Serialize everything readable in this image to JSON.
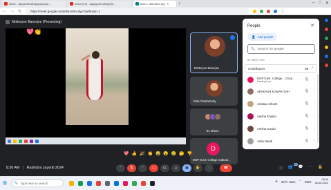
{
  "browser": {
    "tabs": [
      {
        "label": "Inbox - dgcpartich@dgcpapurgo...",
        "color": "#d93025",
        "active": false
      },
      {
        "label": "Inbox (19) - dgcpgovt.college@...",
        "color": "#d93025",
        "active": false
      },
      {
        "label": "Meet - dsk-n8vv-dyy",
        "color": "#00897b",
        "active": true
      }
    ],
    "new_tab": "+",
    "url": "https://meet.google.com/dsk-n8vv-dyy?authuser=1",
    "window_controls": [
      "–",
      "□",
      "✕"
    ]
  },
  "meet": {
    "presenter_label": "Moitreyee Banerjee (Presenting)",
    "tiles": [
      {
        "name": "Moitreyee Banerjee"
      },
      {
        "name": "Dola Chakraborty"
      },
      {
        "name": "81 others"
      },
      {
        "name": "DGP Govt. College Cultural...",
        "initial": "D"
      }
    ],
    "reactions": [
      "💖",
      "👍",
      "🎉",
      "👏",
      "😂",
      "😮",
      "😢",
      "🤔",
      "👎"
    ],
    "time": "8:30 AM",
    "separator": "|",
    "meeting_title": "Rabindra Jayanti 2024",
    "badge": "85"
  },
  "people_panel": {
    "title": "People",
    "add_people": "Add people",
    "search_placeholder": "Search for people",
    "section": "IN MEETING",
    "contributors_label": "Contributors",
    "contributors_count": "85",
    "participants": [
      {
        "name": "DGP Govt. College... (You)",
        "sub": "Meeting host",
        "color": "#e8175d"
      },
      {
        "name": "ABAKASH KUMAR SAH",
        "sub": "",
        "color": "#8d6e63"
      },
      {
        "name": "Amitava Ghosh",
        "sub": "",
        "color": "#c5a27e"
      },
      {
        "name": "Anisha Khatun",
        "sub": "",
        "color": "#ad1457"
      },
      {
        "name": "Anisha Kundu",
        "sub": "",
        "color": "#6d4c41"
      },
      {
        "name": "Anita Nandi",
        "sub": "",
        "color": "#9e9e9e"
      }
    ]
  },
  "taskbar": {
    "search_placeholder": "Type here to search",
    "weather": "24°C Haze",
    "language": "ENG",
    "time": "08:30",
    "date": "06-05-2024"
  }
}
